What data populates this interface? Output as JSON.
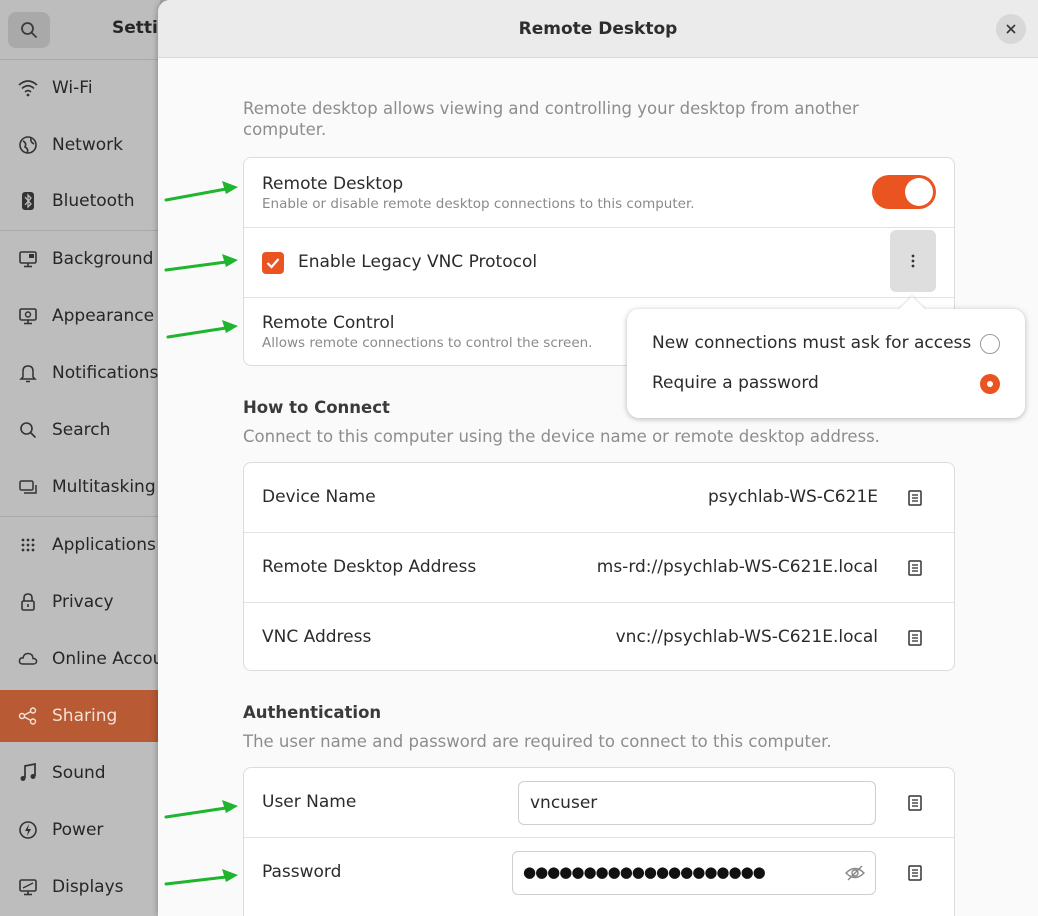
{
  "sidebar": {
    "title": "Setti",
    "items": [
      {
        "label": "Wi-Fi",
        "icon": "wifi-icon"
      },
      {
        "label": "Network",
        "icon": "network-icon"
      },
      {
        "label": "Bluetooth",
        "icon": "bluetooth-icon"
      },
      {
        "label": "Background",
        "icon": "background-icon"
      },
      {
        "label": "Appearance",
        "icon": "appearance-icon"
      },
      {
        "label": "Notifications",
        "icon": "bell-icon"
      },
      {
        "label": "Search",
        "icon": "search-icon"
      },
      {
        "label": "Multitasking",
        "icon": "multitasking-icon"
      },
      {
        "label": "Applications",
        "icon": "grid-icon"
      },
      {
        "label": "Privacy",
        "icon": "lock-icon"
      },
      {
        "label": "Online Accou",
        "icon": "cloud-icon"
      },
      {
        "label": "Sharing",
        "icon": "share-icon"
      },
      {
        "label": "Sound",
        "icon": "music-note-icon"
      },
      {
        "label": "Power",
        "icon": "power-icon"
      },
      {
        "label": "Displays",
        "icon": "display-icon"
      }
    ],
    "active_item": "Sharing"
  },
  "dialog": {
    "title": "Remote Desktop",
    "intro": "Remote desktop allows viewing and controlling your desktop from another computer.",
    "remote_desktop": {
      "title": "Remote Desktop",
      "subtitle": "Enable or disable remote desktop connections to this computer.",
      "enabled": true
    },
    "legacy_vnc": {
      "label": "Enable Legacy VNC Protocol",
      "checked": true
    },
    "remote_control": {
      "title": "Remote Control",
      "subtitle": "Allows remote connections to control the screen."
    },
    "how_to_connect": {
      "title": "How to Connect",
      "subtitle": "Connect to this computer using the device name or remote desktop address.",
      "rows": [
        {
          "label": "Device Name",
          "value": "psychlab-WS-C621E"
        },
        {
          "label": "Remote Desktop Address",
          "value": "ms-rd://psychlab-WS-C621E.local"
        },
        {
          "label": "VNC Address",
          "value": "vnc://psychlab-WS-C621E.local"
        }
      ]
    },
    "authentication": {
      "title": "Authentication",
      "subtitle": "The user name and password are required to connect to this computer.",
      "username_label": "User Name",
      "username_value": "vncuser",
      "password_label": "Password",
      "password_mask": "●●●●●●●●●●●●●●●●●●●●"
    }
  },
  "popover": {
    "options": [
      {
        "label": "New connections must ask for access",
        "selected": false
      },
      {
        "label": "Require a password",
        "selected": true
      }
    ]
  },
  "colors": {
    "accent": "#e95420",
    "annotation_arrow": "#1fb52e"
  }
}
